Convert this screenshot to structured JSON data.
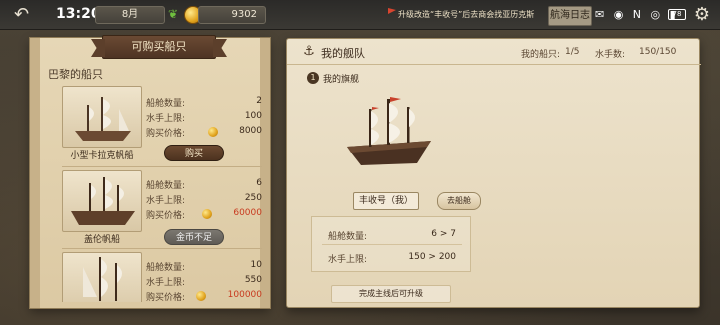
{
  "topbar": {
    "clock": "13:20",
    "month": "8月",
    "gold": "9302",
    "notice": "升级改造“丰收号”后去商会找亚历克斯",
    "voyage_button": "航海日志",
    "status_icons": "✉ ◉ N ◎ ▮",
    "battery": "78"
  },
  "shop": {
    "title": "可购买船只",
    "section": "巴黎的船只",
    "labels": {
      "cabins": "船舱数量:",
      "sailors": "水手上限:",
      "price": "购买价格:"
    },
    "ships": [
      {
        "name": "小型卡拉克帆船",
        "cabins": "2",
        "sailors": "100",
        "price": "8000",
        "button": "购买",
        "affordable": true
      },
      {
        "name": "盖伦帆船",
        "cabins": "6",
        "sailors": "250",
        "price": "60000",
        "button": "金币不足",
        "affordable": false
      },
      {
        "name": "",
        "cabins": "10",
        "sailors": "550",
        "price": "100000",
        "button": "",
        "affordable": false
      }
    ]
  },
  "fleet": {
    "title": "我的舰队",
    "ships_label": "我的船只:",
    "ships_value": "1/5",
    "sailors_label": "水手数:",
    "sailors_value": "150/150",
    "flagship_num": "1",
    "flagship_label": "我的旗舰",
    "flagship_name": "丰收号（我）",
    "dock_button": "去船舱",
    "upgrade": {
      "cabins_label": "船舱数量:",
      "cabins_value": "6 > 7",
      "sailors_label": "水手上限:",
      "sailors_value": "150 > 200"
    },
    "upgrade_note": "完成主线后可升级"
  },
  "colors": {
    "parchment": "#e6d7b6",
    "wood": "#4e3423",
    "price_red": "#c83a1f",
    "gold": "#e0a21c"
  }
}
